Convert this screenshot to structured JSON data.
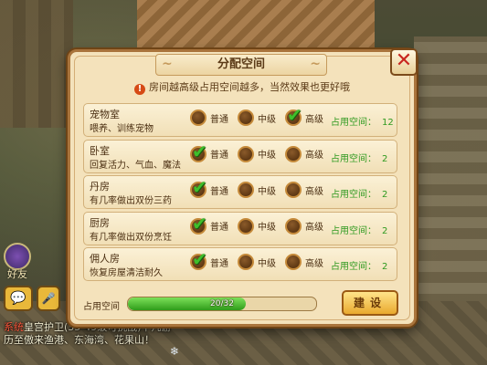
{
  "dialog": {
    "title": "分配空间",
    "notice": "房间越高级占用空间越多，当然效果也更好哦",
    "close_symbol": "✕",
    "option_labels": [
      "普通",
      "中级",
      "高级"
    ],
    "space_label": "占用空间：",
    "rooms": [
      {
        "name": "宠物室",
        "desc": "喂养、训练宠物",
        "selected": "高级",
        "space": "12"
      },
      {
        "name": "卧室",
        "desc": "回复活力、气血、魔法",
        "selected": "普通",
        "space": "2"
      },
      {
        "name": "丹房",
        "desc": "有几率做出双份三药",
        "selected": "普通",
        "space": "2"
      },
      {
        "name": "厨房",
        "desc": "有几率做出双份烹饪",
        "selected": "普通",
        "space": "2"
      },
      {
        "name": "佣人房",
        "desc": "恢复房屋清洁耐久",
        "selected": "普通",
        "space": "2"
      }
    ],
    "usage_label": "占用空间",
    "usage_text": "20/32",
    "usage_used": 20,
    "usage_total": 32,
    "build_label": "建设"
  },
  "hud": {
    "friend_label": "好友",
    "chat_icon": "chat-bubble-icon",
    "mic_icon": "microphone-icon",
    "chat": {
      "line1_tag": "系统",
      "line1_text": "皇宫护卫(35-49级可挑战)下凡游",
      "line2_text": "历至傲来渔港、东海湾、花果山！",
      "snow_symbol": "❄"
    }
  },
  "colors": {
    "accent_green": "#2f9a20",
    "dialog_bg": "#f4e2bb",
    "border_brown": "#a9743c",
    "close_red": "#c8261f"
  }
}
